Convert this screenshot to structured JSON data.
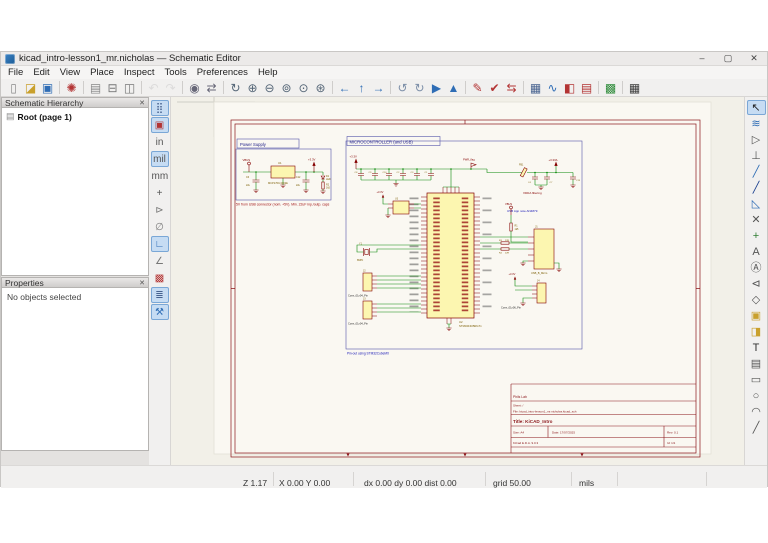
{
  "window": {
    "title": "kicad_intro-lesson1_mr.nicholas — Schematic Editor",
    "controls": [
      {
        "n": "minimize-button",
        "g": "–",
        "c": "#444"
      },
      {
        "n": "maximize-button",
        "g": "▢",
        "c": "#444"
      },
      {
        "n": "close-button",
        "g": "✕",
        "c": "#444"
      }
    ]
  },
  "menu": {
    "items": [
      {
        "n": "menu-file",
        "g": "File"
      },
      {
        "n": "menu-edit",
        "g": "Edit"
      },
      {
        "n": "menu-view",
        "g": "View"
      },
      {
        "n": "menu-place",
        "g": "Place"
      },
      {
        "n": "menu-inspect",
        "g": "Inspect"
      },
      {
        "n": "menu-tools",
        "g": "Tools"
      },
      {
        "n": "menu-preferences",
        "g": "Preferences"
      },
      {
        "n": "menu-help",
        "g": "Help"
      }
    ]
  },
  "toolbar": {
    "items": [
      {
        "n": "new-schematic-icon",
        "g": "▯",
        "c": "#8a8a8a"
      },
      {
        "n": "open-schematic-icon",
        "g": "◪",
        "c": "#c9a02c"
      },
      {
        "n": "save-icon",
        "g": "▣",
        "c": "#2f6db5"
      },
      {
        "sep": true
      },
      {
        "n": "schematic-setup-icon",
        "g": "✺",
        "c": "#b33434"
      },
      {
        "sep": true
      },
      {
        "n": "page-settings-icon",
        "g": "▤",
        "c": "#888888"
      },
      {
        "n": "print-icon",
        "g": "⊟",
        "c": "#777777"
      },
      {
        "n": "paste-icon",
        "g": "◫",
        "c": "#777777"
      },
      {
        "sep": true
      },
      {
        "n": "undo-icon",
        "g": "↶",
        "c": "#c3c3c3",
        "dis": true
      },
      {
        "n": "redo-icon",
        "g": "↷",
        "c": "#c3c3c3",
        "dis": true
      },
      {
        "sep": true
      },
      {
        "n": "find-icon",
        "g": "◉",
        "c": "#666677"
      },
      {
        "n": "find-replace-icon",
        "g": "⇄",
        "c": "#666677"
      },
      {
        "sep": true
      },
      {
        "n": "refresh-view-icon",
        "g": "↻",
        "c": "#556677"
      },
      {
        "n": "zoom-in-icon",
        "g": "⊕",
        "c": "#556677"
      },
      {
        "n": "zoom-out-icon",
        "g": "⊖",
        "c": "#556677"
      },
      {
        "n": "zoom-fit-icon",
        "g": "⊚",
        "c": "#556677"
      },
      {
        "n": "zoom-objects-icon",
        "g": "⊙",
        "c": "#556677"
      },
      {
        "n": "zoom-selection-icon",
        "g": "⊛",
        "c": "#556677"
      },
      {
        "sep": true
      },
      {
        "n": "nav-back-icon",
        "g": "←",
        "c": "#2f6db5"
      },
      {
        "n": "nav-up-hierarchy-icon",
        "g": "↑",
        "c": "#2f6db5"
      },
      {
        "n": "nav-forward-icon",
        "g": "→",
        "c": "#2f6db5"
      },
      {
        "sep": true
      },
      {
        "n": "rotate-ccw-icon",
        "g": "↺",
        "c": "#7d8fa8"
      },
      {
        "n": "rotate-cw-icon",
        "g": "↻",
        "c": "#7d8fa8"
      },
      {
        "n": "mirror-h-icon",
        "g": "▶",
        "c": "#2f6db5"
      },
      {
        "n": "mirror-v-icon",
        "g": "▲",
        "c": "#2f6db5"
      },
      {
        "sep": true
      },
      {
        "n": "annotate-icon",
        "g": "✎",
        "c": "#b33434"
      },
      {
        "n": "erc-icon",
        "g": "✔",
        "c": "#b33434"
      },
      {
        "n": "update-symbols-icon",
        "g": "⇆",
        "c": "#b33434"
      },
      {
        "sep": true
      },
      {
        "n": "symbol-fields-table-icon",
        "g": "▦",
        "c": "#47628f"
      },
      {
        "n": "simulator-icon",
        "g": "∿",
        "c": "#2f6db5"
      },
      {
        "n": "assign-footprints-icon",
        "g": "◧",
        "c": "#b33434"
      },
      {
        "n": "export-bom-icon",
        "g": "▤",
        "c": "#b33434"
      },
      {
        "sep": true
      },
      {
        "n": "footprint-editor-icon",
        "g": "▩",
        "c": "#2e8b3a"
      },
      {
        "sep": true
      },
      {
        "n": "pcb-editor-icon",
        "g": "▦",
        "c": "#3a3a3a"
      }
    ]
  },
  "left_toolbar": {
    "items": [
      {
        "n": "grid-visibility-icon",
        "g": "⣿",
        "c": "#47628f",
        "sel": true
      },
      {
        "n": "grid-overrides-icon",
        "g": "▣",
        "c": "#b33434",
        "sel": true
      },
      {
        "n": "units-inches-icon",
        "g": "in",
        "c": "#555555"
      },
      {
        "n": "units-mils-icon",
        "g": "mil",
        "c": "#555555",
        "sel": true
      },
      {
        "n": "units-mm-icon",
        "g": "mm",
        "c": "#555555"
      },
      {
        "n": "crosshair-cursor-icon",
        "g": "+",
        "c": "#555555"
      },
      {
        "n": "hidden-pins-icon",
        "g": "⊳",
        "c": "#777777"
      },
      {
        "n": "hidden-fields-icon",
        "g": "∅",
        "c": "#777777"
      },
      {
        "n": "line-mode-90-icon",
        "g": "∟",
        "c": "#2f6db5",
        "sel": true
      },
      {
        "n": "line-mode-45-icon",
        "g": "∠",
        "c": "#777777"
      },
      {
        "n": "erc-markers-icon",
        "g": "▩",
        "c": "#b33434"
      },
      {
        "n": "hierarchy-navigator-icon",
        "g": "≣",
        "c": "#47628f",
        "sel": true
      },
      {
        "n": "properties-panel-icon",
        "g": "⚒",
        "c": "#2f6db5",
        "sel": true
      }
    ]
  },
  "right_toolbar": {
    "items": [
      {
        "n": "select-tool-icon",
        "g": "↖",
        "c": "#222222",
        "sel": true
      },
      {
        "n": "highlight-net-icon",
        "g": "≋",
        "c": "#2f6db5"
      },
      {
        "n": "place-symbol-icon",
        "g": "▷",
        "c": "#555555"
      },
      {
        "n": "place-power-port-icon",
        "g": "⊥",
        "c": "#555555"
      },
      {
        "n": "draw-wire-icon",
        "g": "╱",
        "c": "#2f6db5"
      },
      {
        "n": "draw-bus-icon",
        "g": "╱",
        "c": "#1a3f8f"
      },
      {
        "n": "bus-entry-icon",
        "g": "◺",
        "c": "#2f6db5"
      },
      {
        "n": "no-connect-icon",
        "g": "✕",
        "c": "#555555"
      },
      {
        "n": "junction-icon",
        "g": "+",
        "c": "#2e7d32"
      },
      {
        "n": "net-label-icon",
        "g": "A",
        "c": "#555555"
      },
      {
        "n": "net-class-directive-icon",
        "g": "Ⓐ",
        "c": "#555555"
      },
      {
        "n": "global-label-icon",
        "g": "⊲",
        "c": "#555555"
      },
      {
        "n": "hierarchical-label-icon",
        "g": "◇",
        "c": "#555555"
      },
      {
        "n": "hierarchical-sheet-icon",
        "g": "▣",
        "c": "#c9a02c"
      },
      {
        "n": "sheet-pin-icon",
        "g": "◨",
        "c": "#c9a02c"
      },
      {
        "n": "text-icon",
        "g": "T",
        "c": "#333333"
      },
      {
        "n": "text-box-icon",
        "g": "▤",
        "c": "#555555"
      },
      {
        "n": "rectangle-icon",
        "g": "▭",
        "c": "#555555"
      },
      {
        "n": "circle-icon",
        "g": "○",
        "c": "#555555"
      },
      {
        "n": "arc-icon",
        "g": "◠",
        "c": "#555555"
      },
      {
        "n": "line-icon",
        "g": "╱",
        "c": "#555555"
      }
    ]
  },
  "panels": {
    "hierarchy": {
      "title": "Schematic Hierarchy",
      "close": "✕",
      "root": "Root (page 1)"
    },
    "properties": {
      "title": "Properties",
      "close": "✕",
      "empty": "No objects selected"
    }
  },
  "status": {
    "zoom": "Z 1.17",
    "cursor": "X 0.00 Y 0.00",
    "delta": "dx 0.00 dy 0.00 dist 0.00",
    "grid": "grid 50.00",
    "units": "mils"
  },
  "colors": {
    "selection": "#c6dcf3",
    "wire_green": "#0a8a0a",
    "component_red": "#840000",
    "note_blue": "#1414b4",
    "frame_red": "#8a1519"
  },
  "sch": {
    "power_title": "Power Supply",
    "mcu_title": "MICROCONTROLLER (and USB)",
    "note_power": "5V from USB connector (nom. +5V). Min. 22uF inp./outp. caps",
    "note_usb": "USB App note AN4879",
    "note_vdda": "VDDA filtering",
    "note_pinout": "Pin-out using STM32CubeMX",
    "parts": {
      "vbus": "VBUS",
      "p3v3": "+3.3V",
      "p3v3a": "+3.3VA",
      "pwr_flag": "PWR_flag",
      "u1": "U1",
      "u1v": "MCP1700-3302E",
      "c6": "C6",
      "c6v": "22u",
      "c12": "C12",
      "c12v": "22u",
      "d1": "D1",
      "d1v": "LED",
      "r2": "R2",
      "r2v": "1k5",
      "c8": "C8",
      "c9": "C9",
      "c10": "C10",
      "c2": "C2",
      "c3": "C3",
      "c1": "C1",
      "fb1": "FB1",
      "c4": "C4",
      "c7": "C7",
      "c13": "C13",
      "u2": "U2",
      "u2v": "STM32F405RGTx",
      "u3": "U3",
      "y1": "Y1",
      "y1v": "8MHz",
      "j1": "J1",
      "j1v": "USB_B_Micro",
      "j2": "J2",
      "j3": "J3",
      "j4": "J4",
      "conn": "Conn_01x04_Pin",
      "conn6": "Conn_01x06_Pin",
      "r1": "R1",
      "r1v": "1k5",
      "r3": "R3",
      "r4": "R4",
      "r22": "22R"
    },
    "titleblock": {
      "company": "Phils Lab",
      "sheet": "Sheet: /",
      "file": "File: kicad_intro-lesson1_mr.nicholas.kicad_sch",
      "title": "Title: KiCAD_Intro",
      "size": "Size: A4",
      "date": "Date: 17/07/2025",
      "rev": "Rev: 0.1",
      "tool": "KiCad E.D.A. 9.0.3",
      "id": "Id: 1/1"
    }
  }
}
